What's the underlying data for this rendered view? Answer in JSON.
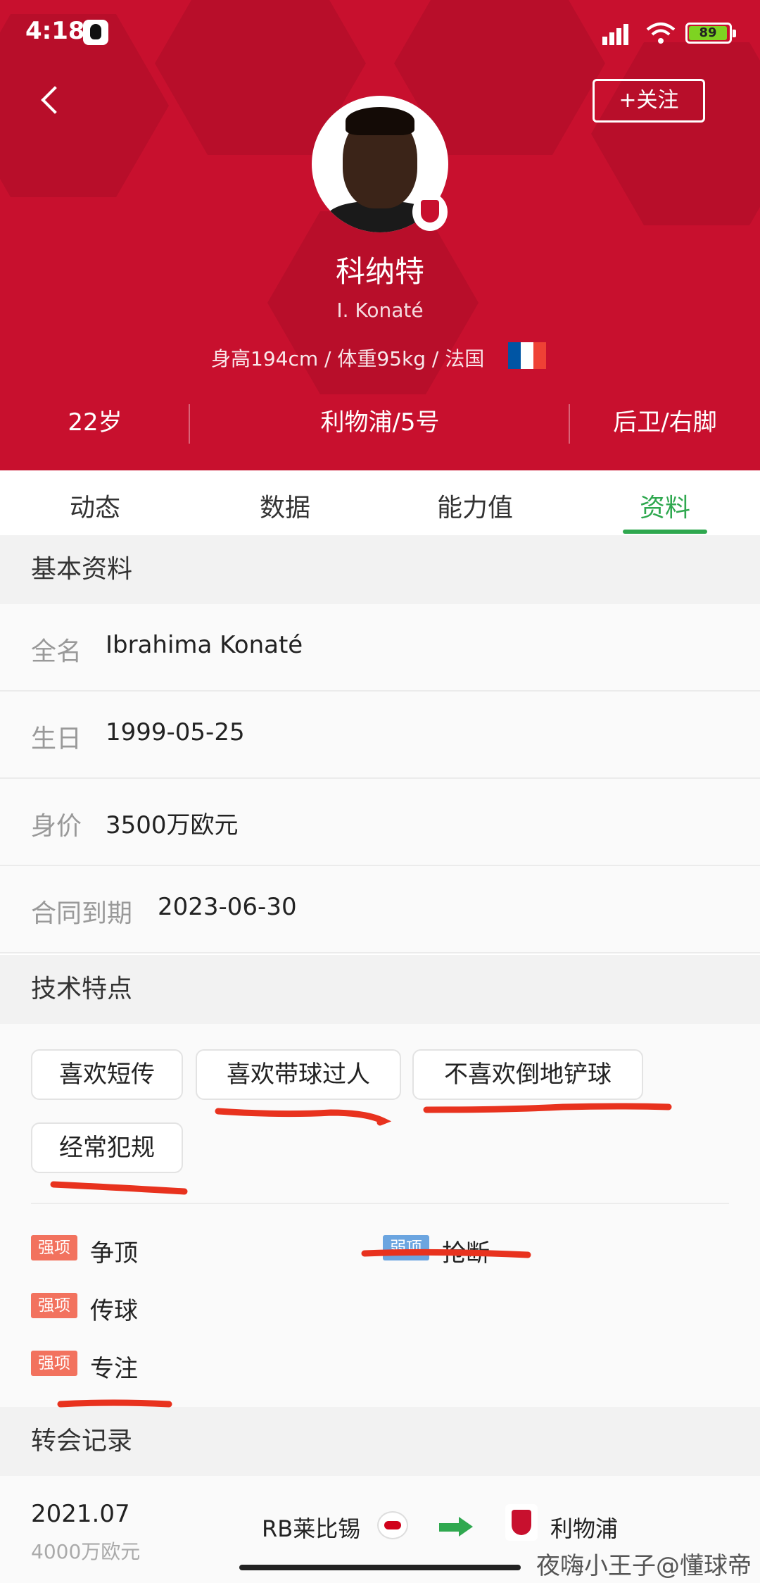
{
  "status_bar": {
    "time": "4:18",
    "battery": "89"
  },
  "header": {
    "follow_label": "+关注",
    "name_cn": "科纳特",
    "name_en": "I. Konaté",
    "body_info": "身高194cm / 体重95kg / 法国",
    "stats": {
      "age": "22岁",
      "club_number": "利物浦/5号",
      "position_foot": "后卫/右脚"
    },
    "colors": {
      "header_bg": "#c8102e",
      "flag": [
        "#0055a4",
        "#ffffff",
        "#ef4135"
      ]
    }
  },
  "tabs": [
    {
      "label": "动态"
    },
    {
      "label": "数据"
    },
    {
      "label": "能力值"
    },
    {
      "label": "资料",
      "active": true
    }
  ],
  "basic_info": {
    "section_title": "基本资料",
    "rows": [
      {
        "label": "全名",
        "value": "Ibrahima Konaté"
      },
      {
        "label": "生日",
        "value": "1999-05-25"
      },
      {
        "label": "身价",
        "value": "3500万欧元"
      },
      {
        "label": "合同到期",
        "value": "2023-06-30"
      }
    ]
  },
  "tech": {
    "section_title": "技术特点",
    "tags": [
      "喜欢短传",
      "喜欢带球过人",
      "不喜欢倒地铲球",
      "经常犯规"
    ],
    "strong_label": "强项",
    "weak_label": "弱项",
    "strengths": [
      "争顶",
      "传球",
      "专注"
    ],
    "weaknesses": [
      "抢断"
    ]
  },
  "transfers": {
    "section_title": "转会记录",
    "items": [
      {
        "date": "2021.07",
        "fee": "4000万欧元",
        "from": "RB莱比锡",
        "to": "利物浦"
      }
    ]
  },
  "watermark": "夜嗨小王子@懂球帝",
  "accent_colors": {
    "active_tab": "#2fa84f",
    "strong": "#f2725e",
    "weak": "#6ba5e0",
    "annotation": "#e8321e"
  }
}
